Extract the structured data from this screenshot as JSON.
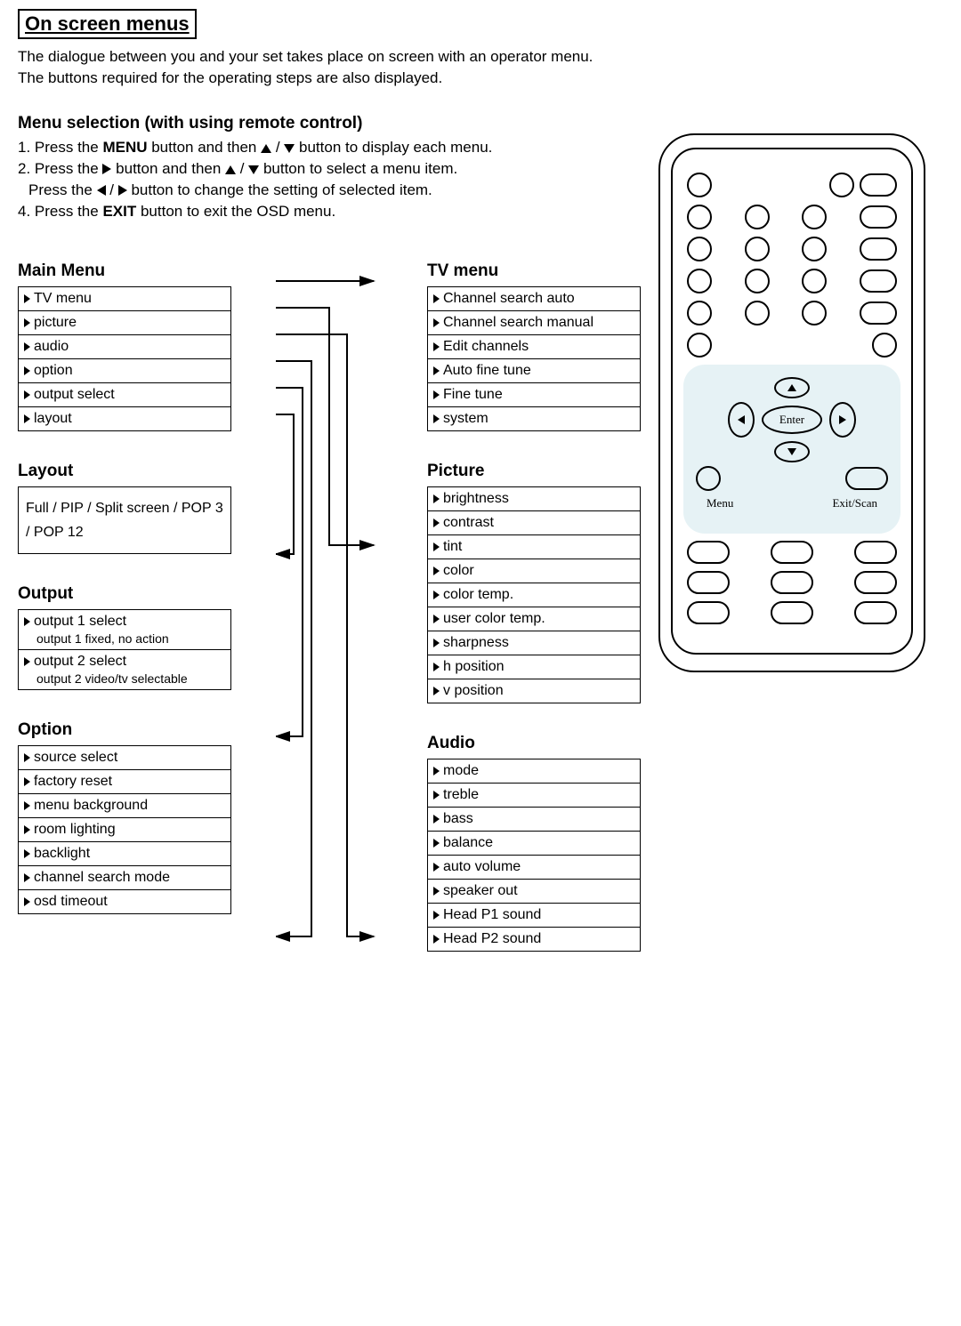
{
  "title": "On screen menus",
  "intro": [
    "The dialogue between you and your set takes place on screen with an operator menu.",
    "The buttons required for the operating steps are also displayed."
  ],
  "selection_heading": "Menu selection (with using remote control)",
  "steps": {
    "s1a": "1. Press the ",
    "s1b": "MENU",
    "s1c": " button and then ",
    "s1d": "button to display each menu.",
    "s2a": "2. Press the ",
    "s2b": " button and then ",
    "s2c": " button to select a menu item.",
    "s3a": "  Press the ",
    "s3b": " button to change the setting of selected item.",
    "s4a": "4. Press the ",
    "s4b": "EXIT",
    "s4c": " button to exit the OSD menu."
  },
  "menus": {
    "main": {
      "title": "Main Menu",
      "items": [
        "TV menu",
        "picture",
        "audio",
        "option",
        "output select",
        "layout"
      ]
    },
    "layout": {
      "title": "Layout",
      "text": "Full / PIP / Split screen / POP 3 / POP 12"
    },
    "output": {
      "title": "Output",
      "items": [
        {
          "label": "output 1 select",
          "sub": "output 1 fixed, no action"
        },
        {
          "label": "output 2 select",
          "sub": "output 2 video/tv selectable"
        }
      ]
    },
    "option": {
      "title": "Option",
      "items": [
        "source select",
        "factory reset",
        "menu background",
        "room lighting",
        "backlight",
        "channel search mode",
        "osd timeout"
      ]
    },
    "tv": {
      "title": "TV menu",
      "items": [
        "Channel search auto",
        "Channel search manual",
        "Edit channels",
        "Auto fine tune",
        "Fine tune",
        "system"
      ]
    },
    "picture": {
      "title": "Picture",
      "items": [
        "brightness",
        "contrast",
        "tint",
        "color",
        "color temp.",
        "user color temp.",
        "sharpness",
        "h position",
        "v position"
      ]
    },
    "audio": {
      "title": "Audio",
      "items": [
        "mode",
        "treble",
        "bass",
        "balance",
        "auto volume",
        "speaker out",
        "Head P1 sound",
        "Head P2 sound"
      ]
    }
  },
  "remote": {
    "enter": "Enter",
    "menu": "Menu",
    "exit": "Exit/Scan"
  }
}
